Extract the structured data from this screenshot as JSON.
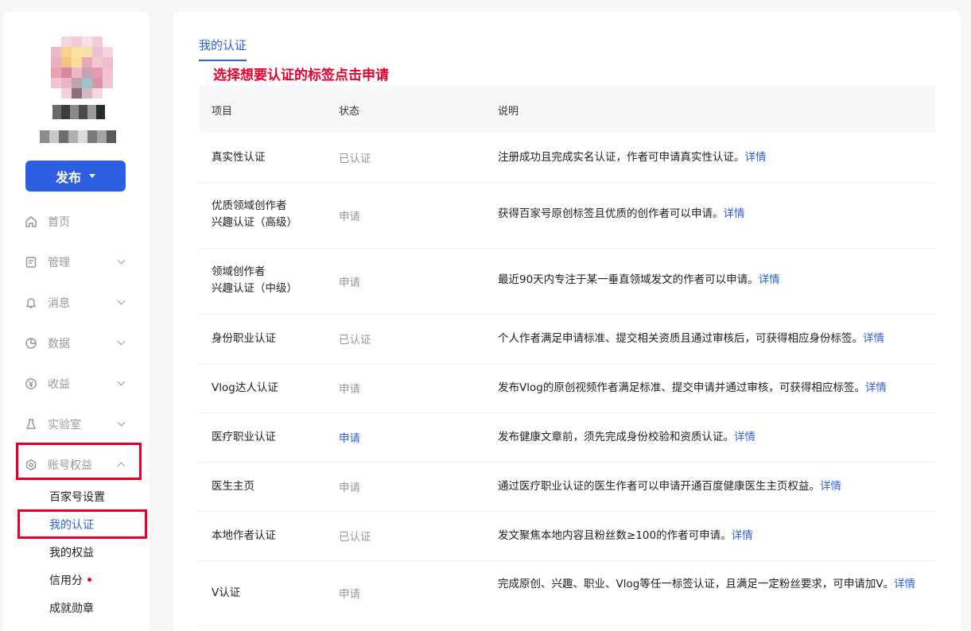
{
  "sidebar": {
    "publish_label": "发布",
    "nav": [
      {
        "label": "首页"
      },
      {
        "label": "管理"
      },
      {
        "label": "消息"
      },
      {
        "label": "数据"
      },
      {
        "label": "收益"
      },
      {
        "label": "实验室"
      },
      {
        "label": "账号权益"
      }
    ],
    "sub_items": [
      {
        "label": "百家号设置"
      },
      {
        "label": "我的认证"
      },
      {
        "label": "我的权益"
      },
      {
        "label": "信用分"
      },
      {
        "label": "成就勋章"
      }
    ]
  },
  "main": {
    "tab_title": "我的认证",
    "annotation": "选择想要认证的标签点击申请",
    "headers": [
      "项目",
      "状态",
      "说明"
    ],
    "detail_label": "详情",
    "rows": [
      {
        "name_line1": "真实性认证",
        "name_line2": "",
        "status": "已认证",
        "desc": "注册成功且完成实名认证，作者可申请真实性认证。"
      },
      {
        "name_line1": "优质领域创作者",
        "name_line2": "兴趣认证（高级）",
        "status": "申请",
        "desc": "获得百家号原创标签且优质的创作者可以申请。"
      },
      {
        "name_line1": "领域创作者",
        "name_line2": "兴趣认证（中级）",
        "status": "申请",
        "desc": "最近90天内专注于某一垂直领域发文的作者可以申请。"
      },
      {
        "name_line1": "身份职业认证",
        "name_line2": "",
        "status": "已认证",
        "desc": "个人作者满足申请标准、提交相关资质且通过审核后，可获得相应身份标签。"
      },
      {
        "name_line1": "Vlog达人认证",
        "name_line2": "",
        "status": "申请",
        "desc": "发布Vlog的原创视频作者满足标准、提交申请并通过审核，可获得相应标签。"
      },
      {
        "name_line1": "医疗职业认证",
        "name_line2": "",
        "status": "申请",
        "desc": "发布健康文章前，须先完成身份校验和资质认证。"
      },
      {
        "name_line1": "医生主页",
        "name_line2": "",
        "status": "申请",
        "desc": "通过医疗职业认证的医生作者可以申请开通百度健康医生主页权益。"
      },
      {
        "name_line1": "本地作者认证",
        "name_line2": "",
        "status": "已认证",
        "desc": "发文聚焦本地内容且粉丝数≥100的作者可申请。"
      },
      {
        "name_line1": "V认证",
        "name_line2": "",
        "status": "申请",
        "desc": "完成原创、兴趣、职业、Vlog等任一标签认证，且满足一定粉丝要求，可申请加V。"
      }
    ]
  },
  "colors": {
    "accent": "#2e5fe0",
    "highlight": "#e8002d",
    "muted": "#9499a0"
  }
}
